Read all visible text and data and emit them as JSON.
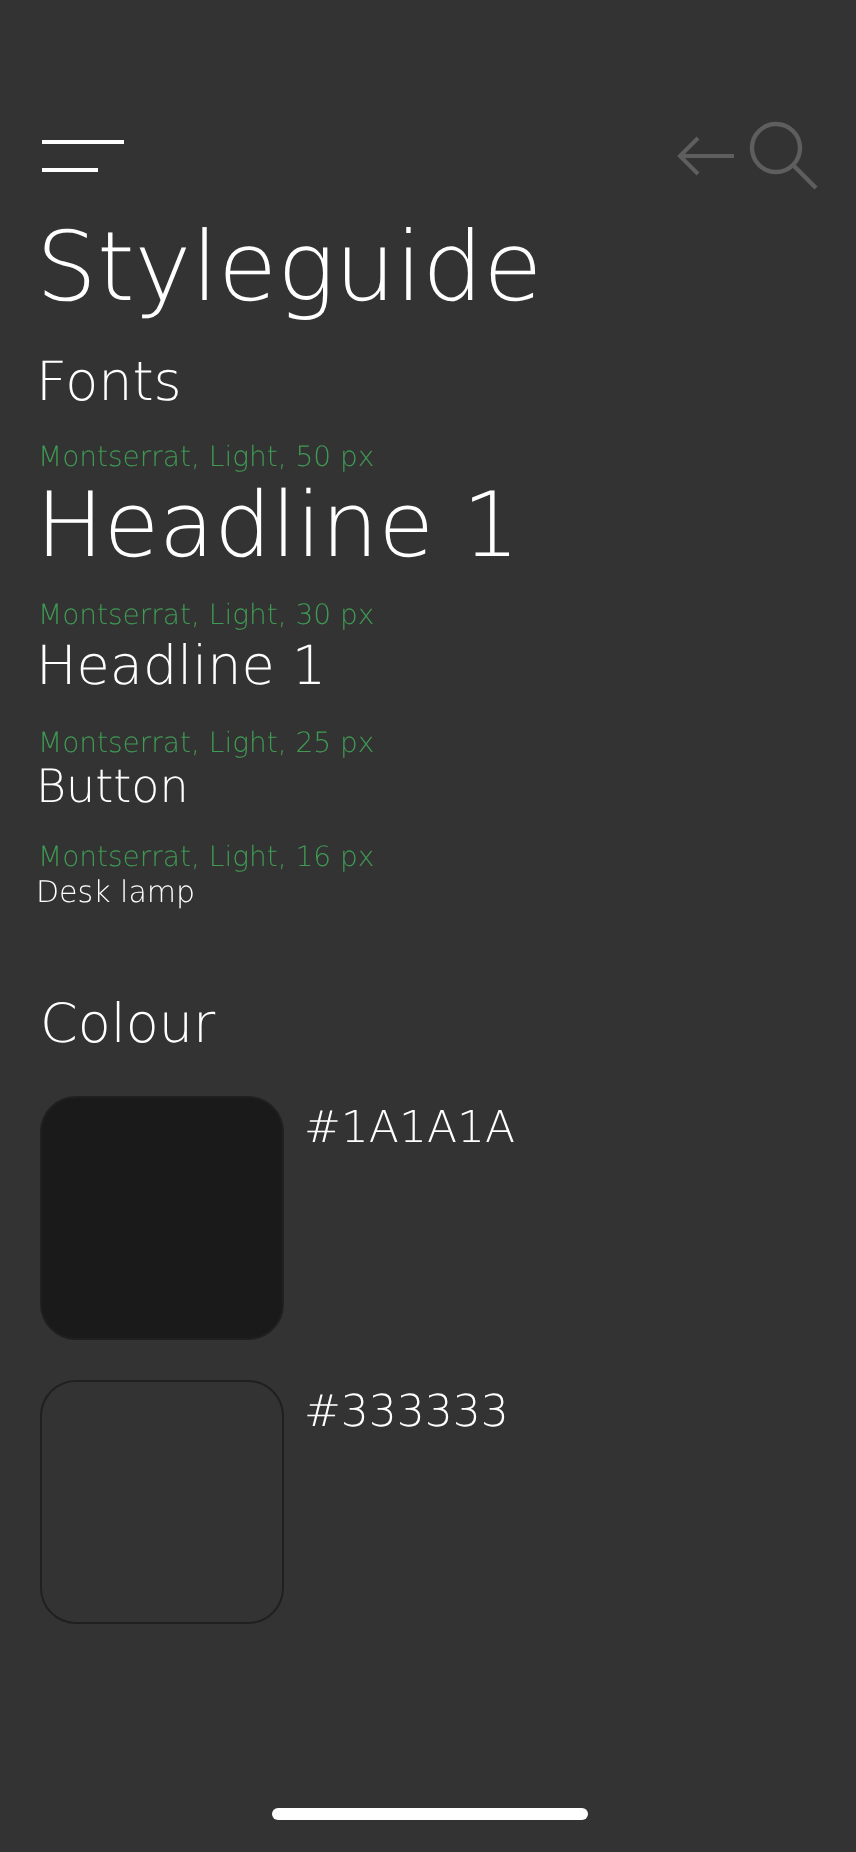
{
  "title": "Styleguide",
  "fonts": {
    "heading": "Fonts",
    "samples": [
      {
        "caption": "Montserrat, Light, 50 px",
        "sample": "Headline 1",
        "kind": "h1"
      },
      {
        "caption": "Montserrat, Light, 30 px",
        "sample": "Headline 1",
        "kind": "h2"
      },
      {
        "caption": "Montserrat, Light, 25 px",
        "sample": "Button",
        "kind": "button"
      },
      {
        "caption": "Montserrat, Light, 16 px",
        "sample": "Desk lamp",
        "kind": "body"
      }
    ]
  },
  "colour": {
    "heading": "Colour",
    "swatches": [
      {
        "label": "#1A1A1A",
        "color": "#1a1a1a"
      },
      {
        "label": "#333333",
        "color": "#333333"
      }
    ]
  }
}
